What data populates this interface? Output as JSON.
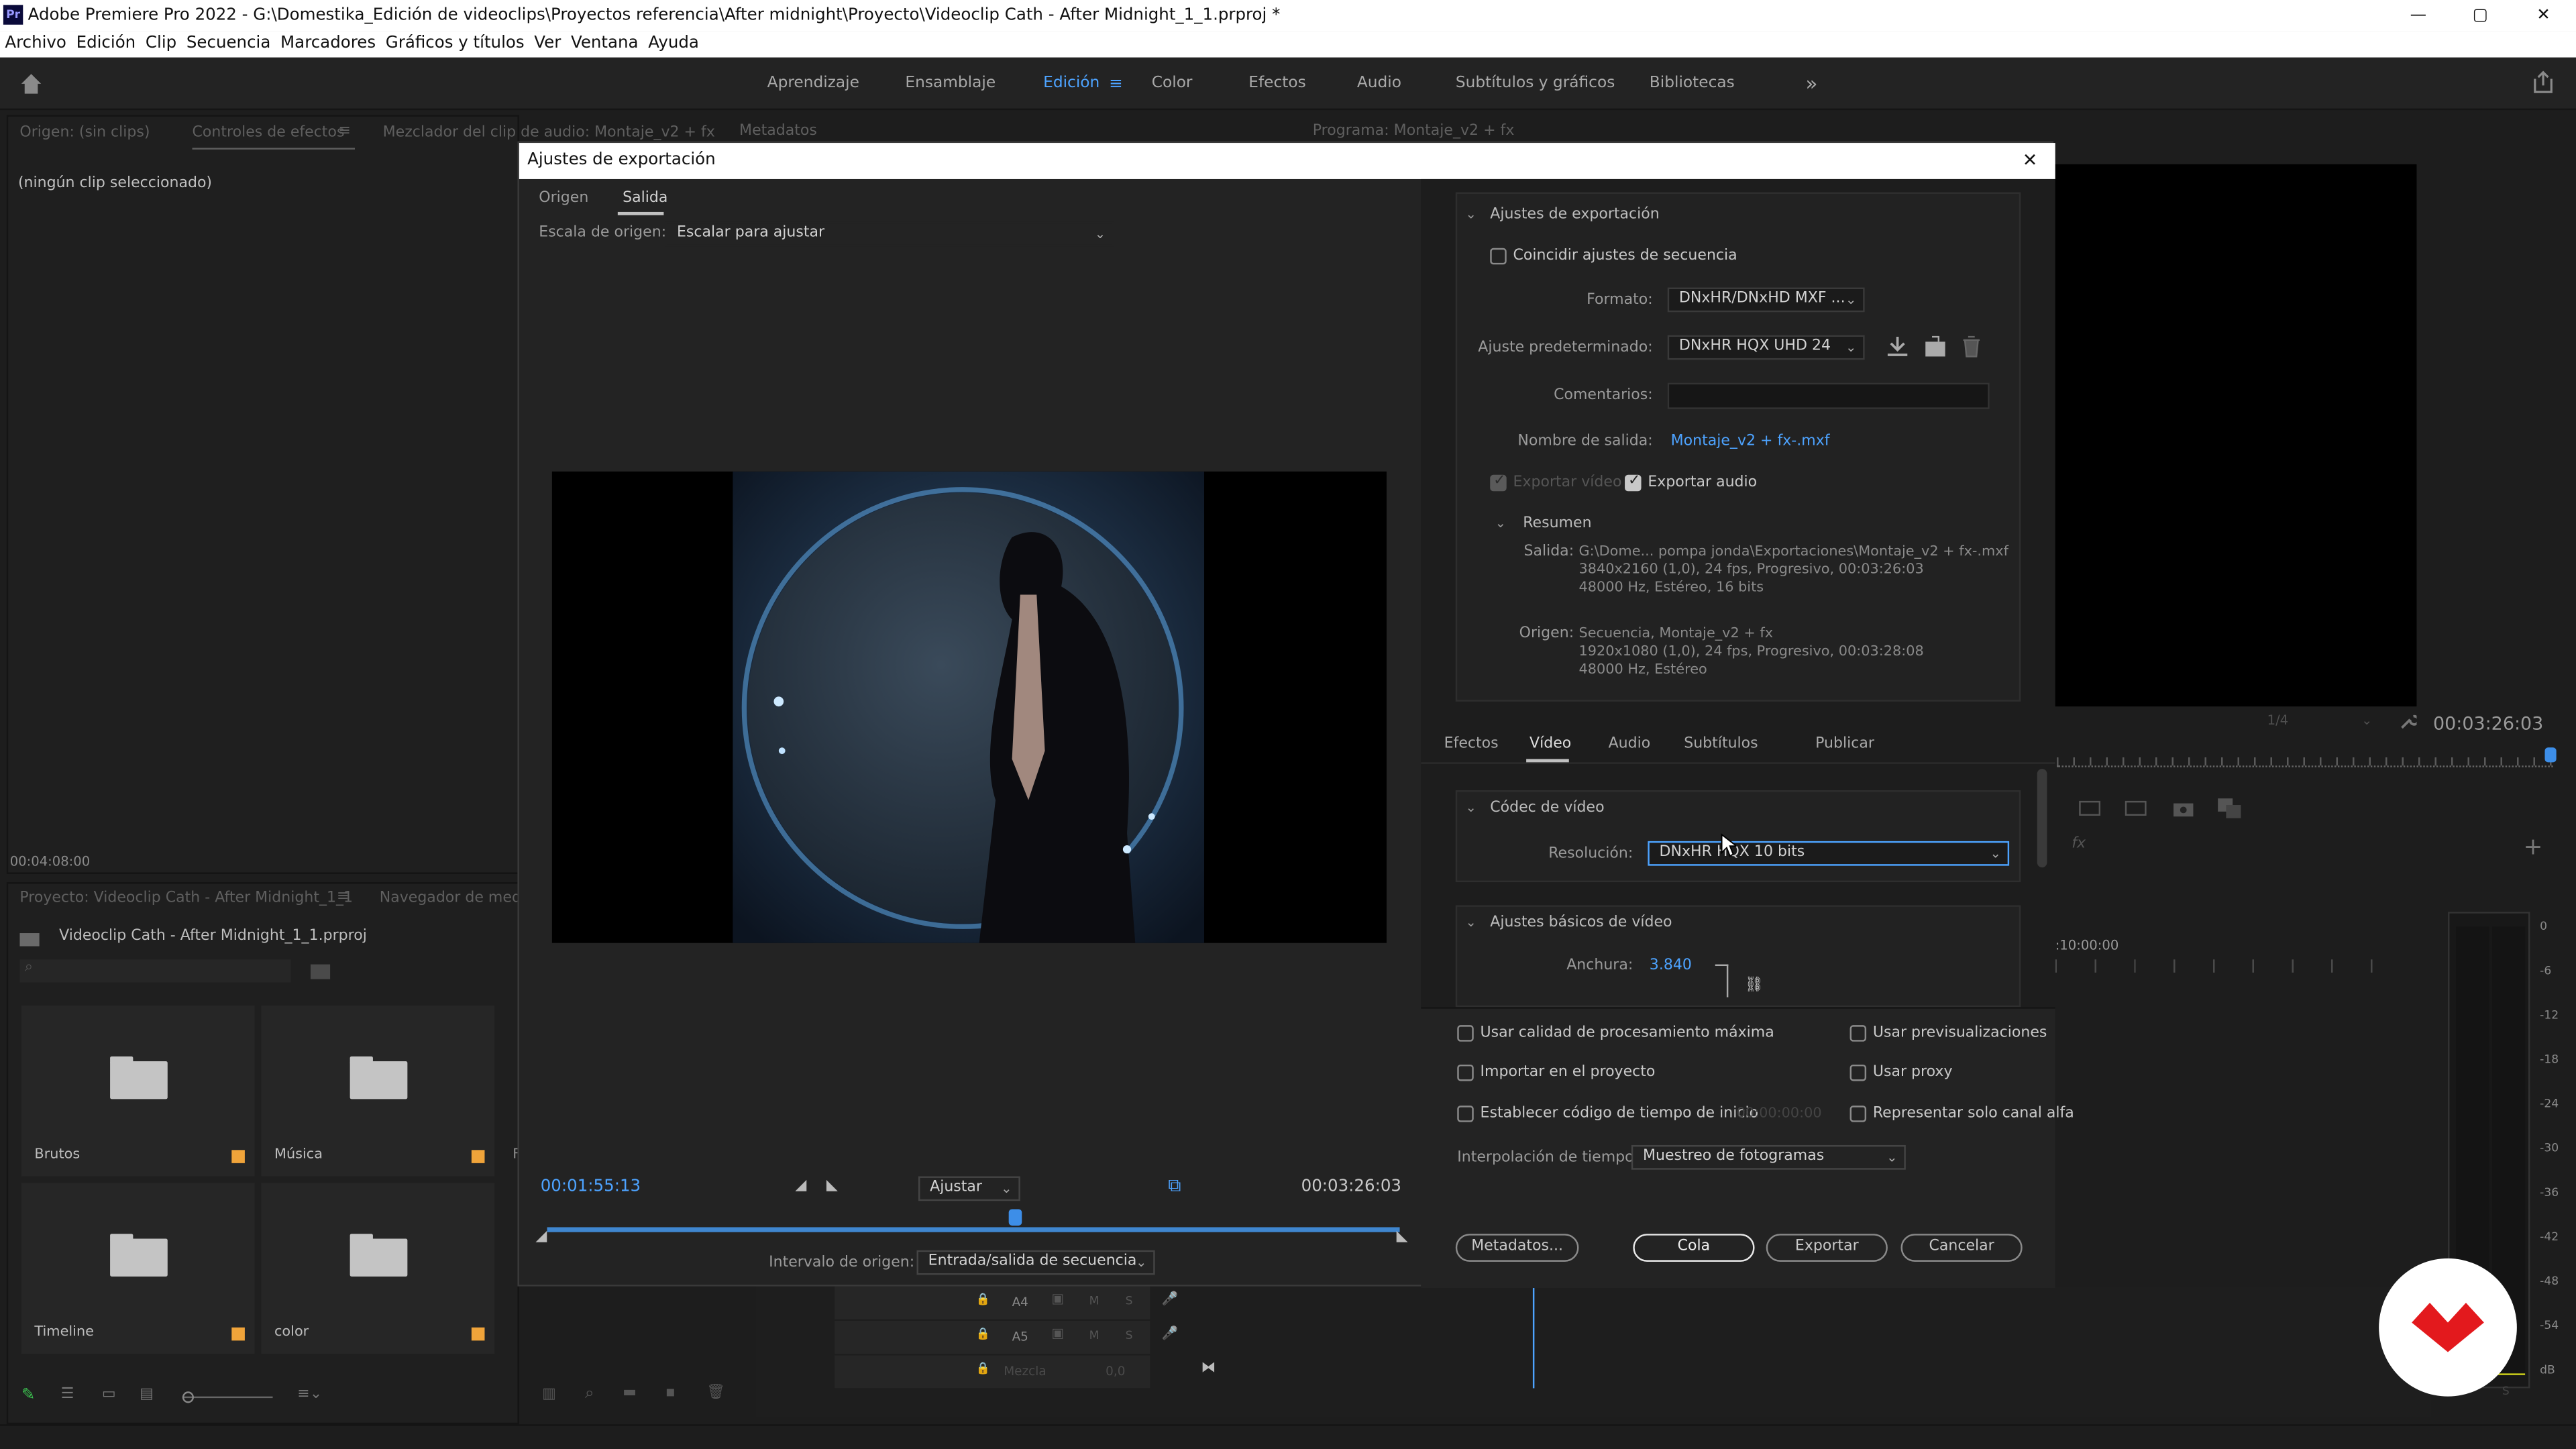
{
  "window": {
    "app_badge": "Pr",
    "title": "Adobe Premiere Pro 2022 - G:\\Domestika_Edición de videoclips\\Proyectos referencia\\After midnight\\Proyecto\\Videoclip Cath - After Midnight_1_1.prproj *",
    "minimize": "—",
    "maximize": "▢",
    "close": "✕"
  },
  "menu": [
    "Archivo",
    "Edición",
    "Clip",
    "Secuencia",
    "Marcadores",
    "Gráficos y títulos",
    "Ver",
    "Ventana",
    "Ayuda"
  ],
  "workspaces": {
    "tabs": [
      "Aprendizaje",
      "Ensamblaje",
      "Edición",
      "Color",
      "Efectos",
      "Audio",
      "Subtítulos y gráficos",
      "Bibliotecas"
    ],
    "active": "Edición",
    "more": "»"
  },
  "source_panel": {
    "tabs": [
      "Origen: (sin clips)",
      "Controles de efectos",
      "Mezclador del clip de audio: Montaje_v2 + fx",
      "Metadatos"
    ],
    "no_clip": "(ningún clip seleccionado)",
    "timecode": "00:04:08:00"
  },
  "program_panel": {
    "tab": "Programa: Montaje_v2 + fx",
    "zoom_select": "1/4",
    "timecode": "00:03:26:03"
  },
  "project_panel": {
    "tabs": [
      "Proyecto: Videoclip Cath - After Midnight_1_1",
      "Navegador de medio"
    ],
    "project_file": "Videoclip Cath - After Midnight_1_1.prproj",
    "bins": [
      {
        "name": "Brutos"
      },
      {
        "name": "Música"
      },
      {
        "name": "Timeline"
      },
      {
        "name": "color"
      }
    ],
    "clipped_label": "F"
  },
  "timeline": {
    "ruler_time": ":10:00:00",
    "tracks": [
      {
        "name": "A4",
        "m": "M",
        "s": "S"
      },
      {
        "name": "A5",
        "m": "M",
        "s": "S"
      }
    ],
    "mix_label": "Mezcla",
    "mix_value": "0,0"
  },
  "meter": {
    "scale": [
      "0",
      "-6",
      "-12",
      "-18",
      "-24",
      "-30",
      "-36",
      "-42",
      "-48",
      "-54",
      "dB"
    ],
    "solo": [
      "S",
      "S"
    ]
  },
  "dialog": {
    "title": "Ajustes de exportación",
    "close": "✕",
    "preview_tabs": [
      "Origen",
      "Salida"
    ],
    "active_preview_tab": "Salida",
    "source_scale_label": "Escala de origen:",
    "source_scale_value": "Escalar para ajustar",
    "current_time": "00:01:55:13",
    "fit_value": "Ajustar",
    "duration": "00:03:26:03",
    "source_range_label": "Intervalo de origen:",
    "source_range_value": "Entrada/salida de secuencia",
    "playhead_fraction": 0.55,
    "export_settings": {
      "section_title": "Ajustes de exportación",
      "match_sequence": "Coincidir ajustes de secuencia",
      "format_label": "Formato:",
      "format_value": "DNxHR/DNxHD MXF ...",
      "preset_label": "Ajuste predeterminado:",
      "preset_value": "DNxHR HQX UHD 24",
      "comments_label": "Comentarios:",
      "output_name_label": "Nombre de salida:",
      "output_name_value": "Montaje_v2 + fx-.mxf",
      "export_video": "Exportar vídeo",
      "export_audio": "Exportar audio",
      "summary_title": "Resumen",
      "output_label": "Salida:",
      "output_lines": [
        "G:\\Dome... pompa jonda\\Exportaciones\\Montaje_v2 + fx-.mxf",
        "3840x2160 (1,0), 24 fps, Progresivo, 00:03:26:03",
        "48000 Hz, Estéreo, 16 bits"
      ],
      "source_label": "Origen:",
      "source_lines": [
        "Secuencia, Montaje_v2 + fx",
        "1920x1080 (1,0), 24 fps, Progresivo, 00:03:28:08",
        "48000 Hz, Estéreo"
      ]
    },
    "tabs": [
      "Efectos",
      "Vídeo",
      "Audio",
      "Subtítulos",
      "Publicar"
    ],
    "active_tab": "Vídeo",
    "video": {
      "codec_section": "Códec de vídeo",
      "resolution_label": "Resolución:",
      "resolution_value": "DNxHR HQX 10 bits",
      "basic_section": "Ajustes básicos de vídeo",
      "width_label": "Anchura:",
      "width_value": "3.840"
    },
    "options": {
      "max_quality": "Usar calidad de procesamiento máxima",
      "use_previews": "Usar previsualizaciones",
      "import_project": "Importar en el proyecto",
      "use_proxy": "Usar proxy",
      "start_timecode": "Establecer código de tiempo de inicio",
      "start_timecode_value": "00:00:00:00",
      "alpha_only": "Representar solo canal alfa",
      "interp_label": "Interpolación de tiempo:",
      "interp_value": "Muestreo de fotogramas"
    },
    "buttons": {
      "metadata": "Metadatos...",
      "queue": "Cola",
      "export": "Exportar",
      "cancel": "Cancelar"
    }
  },
  "colors": {
    "accent": "#4da3ff",
    "bin_tag": "#f0a43a",
    "domestika": "#e3191d"
  }
}
